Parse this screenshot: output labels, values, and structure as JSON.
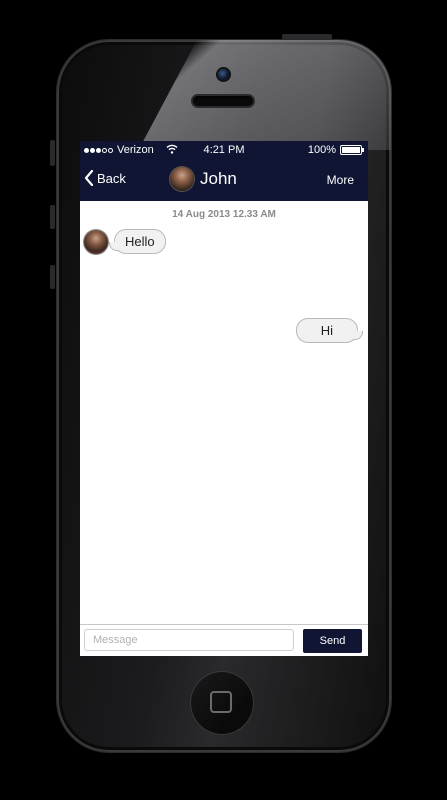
{
  "status_bar": {
    "carrier": "Verizon",
    "signal_bars_filled": 3,
    "signal_bars_total": 5,
    "time": "4:21 PM",
    "battery": "100%"
  },
  "nav": {
    "back_label": "Back",
    "contact_name": "John",
    "more_label": "More"
  },
  "conversation": {
    "timestamp": "14 Aug 2013 12.33 AM",
    "messages": [
      {
        "direction": "incoming",
        "text": "Hello"
      },
      {
        "direction": "outgoing",
        "text": "Hi"
      }
    ]
  },
  "composer": {
    "placeholder": "Message",
    "value": "",
    "send_label": "Send"
  },
  "colors": {
    "bar": "#0f1533",
    "bubble": "#f1f1f1"
  }
}
